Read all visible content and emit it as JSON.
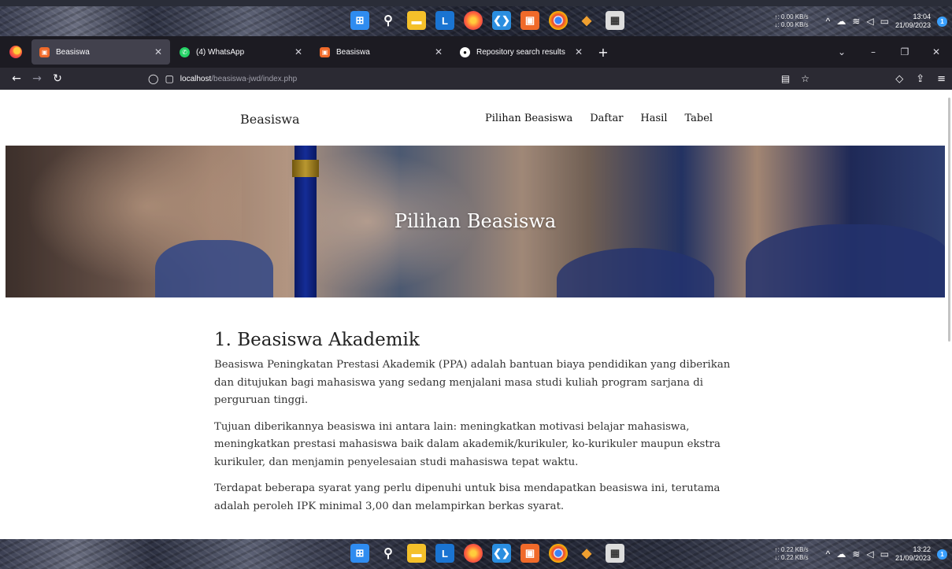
{
  "taskbar_top": {
    "net_up": "↑: 0.00 KB/s",
    "net_down": "↓: 0.00 KB/s",
    "time": "13:04",
    "date": "21/09/2023",
    "notif_count": "1"
  },
  "taskbar_bottom": {
    "net_up": "↑: 0.22 KB/s",
    "net_down": "↓: 0.22 KB/s",
    "time": "13:22",
    "date": "21/09/2023",
    "notif_count": "1"
  },
  "taskbar_apps": [
    "start",
    "search",
    "files",
    "L",
    "firefox",
    "vscode",
    "beasiswa-app",
    "chrome",
    "git",
    "image"
  ],
  "tabs": [
    {
      "title": "Beasiswa",
      "favicon": "orange",
      "active": true
    },
    {
      "title": "(4) WhatsApp",
      "favicon": "green",
      "active": false
    },
    {
      "title": "Beasiswa",
      "favicon": "orange",
      "active": false
    },
    {
      "title": "Repository search results",
      "favicon": "gh",
      "active": false
    }
  ],
  "url": {
    "host": "localhost",
    "path": "/beasiswa-jwd/index.php"
  },
  "site": {
    "brand": "Beasiswa",
    "menu": [
      "Pilihan Beasiswa",
      "Daftar",
      "Hasil",
      "Tabel"
    ],
    "hero_title": "Pilihan Beasiswa"
  },
  "section": {
    "heading": "1. Beasiswa Akademik",
    "paragraphs": [
      "Beasiswa Peningkatan Prestasi Akademik (PPA) adalah bantuan biaya pendidikan yang diberikan dan ditujukan bagi mahasiswa yang sedang menjalani masa studi kuliah program sarjana di perguruan tinggi.",
      "Tujuan diberikannya beasiswa ini antara lain: meningkatkan motivasi belajar mahasiswa, meningkatkan prestasi mahasiswa baik dalam akademik/kurikuler, ko-kurikuler maupun ekstra kurikuler, dan menjamin penyelesaian studi mahasiswa tepat waktu.",
      "Terdapat beberapa syarat yang perlu dipenuhi untuk bisa mendapatkan beasiswa ini, terutama adalah peroleh IPK minimal 3,00 dan melampirkan berkas syarat."
    ]
  },
  "colors": {
    "tab_bg": "#1c1b22",
    "active_tab": "#42414d",
    "nav_bg": "#2b2a33",
    "accent": "#f06a2a"
  }
}
